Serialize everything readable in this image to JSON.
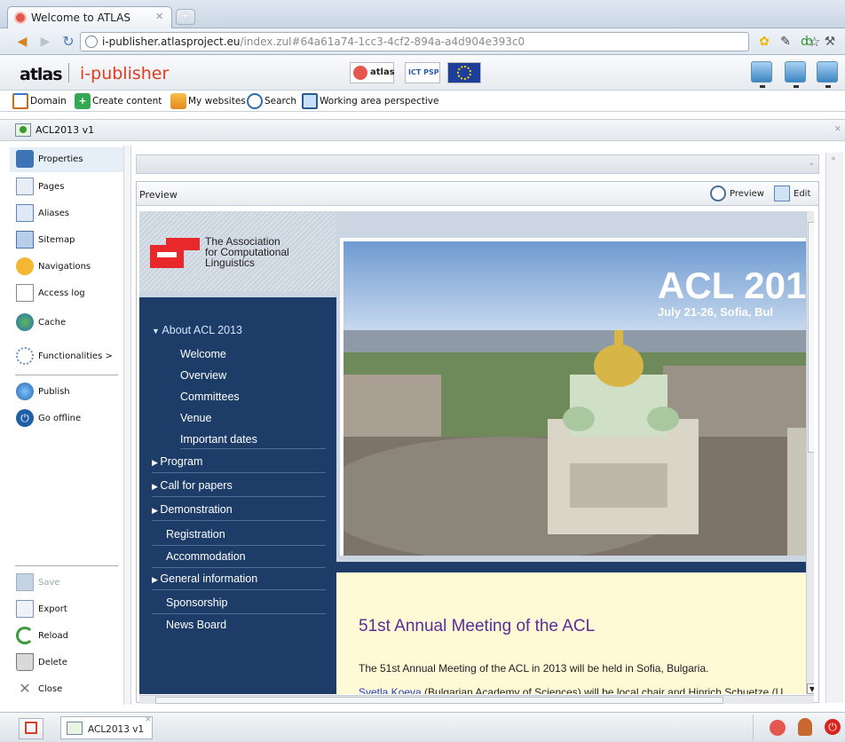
{
  "browser": {
    "tab_title": "Welcome to ATLAS",
    "url_host": "i-publisher.atlasproject.eu",
    "url_path": "/index.zul#64a61a74-1cc3-4cf2-894a-a4d904e393c0"
  },
  "app": {
    "logo_atlas": "atlas",
    "logo_product": "i-publisher",
    "sponsor_atlas": "atlas",
    "sponsor_ict": "ICT PSP"
  },
  "toolbar": {
    "domain": "Domain",
    "create_content": "Create content",
    "my_websites": "My websites",
    "search": "Search",
    "working_area": "Working area perspective"
  },
  "window_tab": {
    "title": "ACL2013 v1"
  },
  "sidebar": {
    "items": [
      {
        "label": "Properties"
      },
      {
        "label": "Pages"
      },
      {
        "label": "Aliases"
      },
      {
        "label": "Sitemap"
      },
      {
        "label": "Navigations"
      },
      {
        "label": "Access log"
      },
      {
        "label": "Cache"
      },
      {
        "label": "Functionalities >"
      },
      {
        "label": "Publish"
      },
      {
        "label": "Go offline"
      }
    ],
    "bottom_items": [
      {
        "label": "Save"
      },
      {
        "label": "Export"
      },
      {
        "label": "Reload"
      },
      {
        "label": "Delete"
      },
      {
        "label": "Close"
      }
    ]
  },
  "preview": {
    "panel_title": "Preview",
    "preview_button": "Preview",
    "edit_button": "Edit"
  },
  "acl_site": {
    "org_line1": "The Association",
    "org_line2": "for Computational",
    "org_line3": "Linguistics",
    "hero_title": "ACL 201",
    "hero_subtitle": "July 21-26, Sofia, Bul",
    "nav": [
      {
        "label": "About ACL 2013",
        "kind": "open"
      },
      {
        "label": "Welcome",
        "kind": "sub"
      },
      {
        "label": "Overview",
        "kind": "sub"
      },
      {
        "label": "Committees",
        "kind": "sub"
      },
      {
        "label": "Venue",
        "kind": "sub"
      },
      {
        "label": "Important dates",
        "kind": "sub"
      },
      {
        "label": "Program",
        "kind": "closed"
      },
      {
        "label": "Call for papers",
        "kind": "closed"
      },
      {
        "label": "Demonstration",
        "kind": "closed"
      },
      {
        "label": "Registration",
        "kind": "plain"
      },
      {
        "label": "Accommodation",
        "kind": "plain"
      },
      {
        "label": "General information",
        "kind": "closed"
      },
      {
        "label": "Sponsorship",
        "kind": "plain"
      },
      {
        "label": "News Board",
        "kind": "plain"
      }
    ],
    "content_title": "51st Annual Meeting of the ACL",
    "content_p1": "The 51st Annual Meeting of the ACL in 2013 will be held in Sofia, Bulgaria.",
    "content_p2_link": "Svetla Koeva",
    "content_p2_rest": " (Bulgarian Academy of Sciences) will be local chair and Hinrich Schuetze (U"
  },
  "taskbar": {
    "window_label": "ACL2013 v1"
  },
  "colors": {
    "brand_red": "#e23b1f",
    "nav_blue": "#1d3c67",
    "content_bg": "#fff9d6",
    "title_purple": "#5b2c9a"
  }
}
